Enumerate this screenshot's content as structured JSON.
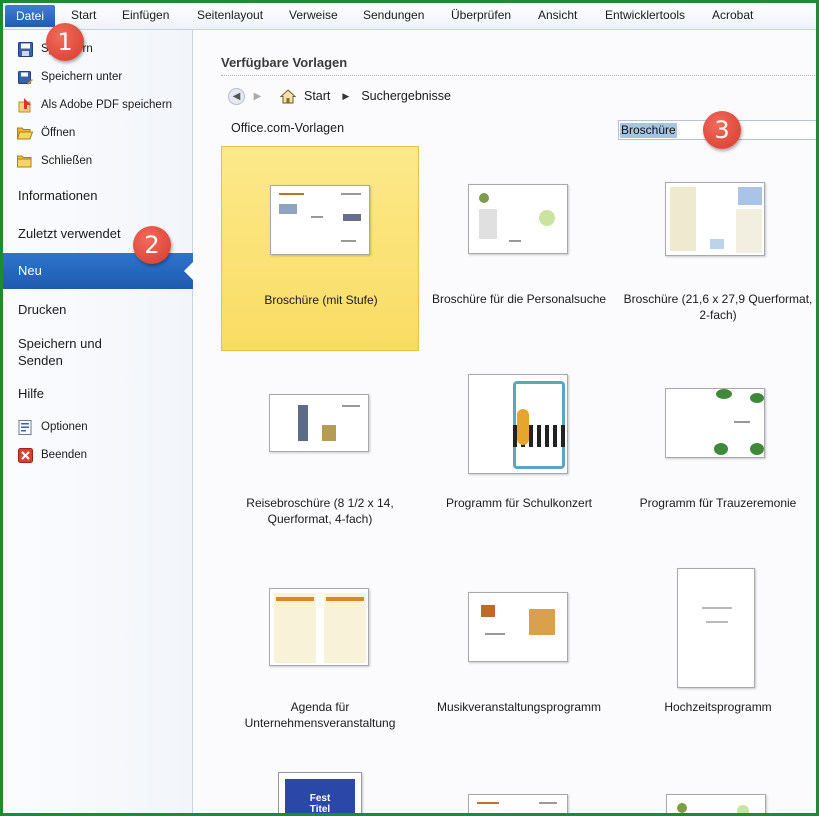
{
  "ribbon": {
    "tabs": [
      "Datei",
      "Start",
      "Einfügen",
      "Seitenlayout",
      "Verweise",
      "Sendungen",
      "Überprüfen",
      "Ansicht",
      "Entwicklertools",
      "Acrobat"
    ]
  },
  "backstage": {
    "commands": [
      {
        "label": "Speichern",
        "icon": "save-icon"
      },
      {
        "label": "Speichern unter",
        "icon": "save-as-icon"
      },
      {
        "label": "Als Adobe PDF speichern",
        "icon": "pdf-icon"
      },
      {
        "label": "Öffnen",
        "icon": "open-folder-icon"
      },
      {
        "label": "Schließen",
        "icon": "close-folder-icon"
      }
    ],
    "sections": {
      "informationen": "Informationen",
      "zuletzt": "Zuletzt verwendet",
      "neu": "Neu",
      "drucken": "Drucken",
      "speichern_senden": "Speichern und Senden",
      "hilfe": "Hilfe"
    },
    "bottom_commands": [
      {
        "label": "Optionen",
        "icon": "options-icon"
      },
      {
        "label": "Beenden",
        "icon": "exit-icon"
      }
    ]
  },
  "callouts": [
    "1",
    "2",
    "3"
  ],
  "main": {
    "heading": "Verfügbare Vorlagen",
    "breadcrumb": {
      "home": "Start",
      "current": "Suchergebnisse"
    },
    "section_label": "Office.com-Vorlagen",
    "search_value": "Broschüre",
    "templates": [
      {
        "label": "Broschüre (mit Stufe)",
        "selected": true
      },
      {
        "label": "Broschüre für die Personalsuche"
      },
      {
        "label": "Broschüre (21,6 x 27,9 Querformat, 2-fach)"
      },
      {
        "label": "Reisebroschüre (8 1/2 x 14, Querformat, 4-fach)"
      },
      {
        "label": "Programm für Schulkonzert"
      },
      {
        "label": "Programm für Trauzeremonie"
      },
      {
        "label": "Agenda für Unternehmensveranstaltung"
      },
      {
        "label": "Musikveranstaltungsprogramm"
      },
      {
        "label": "Hochzeitsprogramm"
      }
    ],
    "partial_thumb_text": "Fest Titel"
  },
  "colors": {
    "frame": "#1e8a32",
    "file_tab": "#2e6fc6",
    "selection": "#fbe27a",
    "callout": "#e04a3a"
  }
}
